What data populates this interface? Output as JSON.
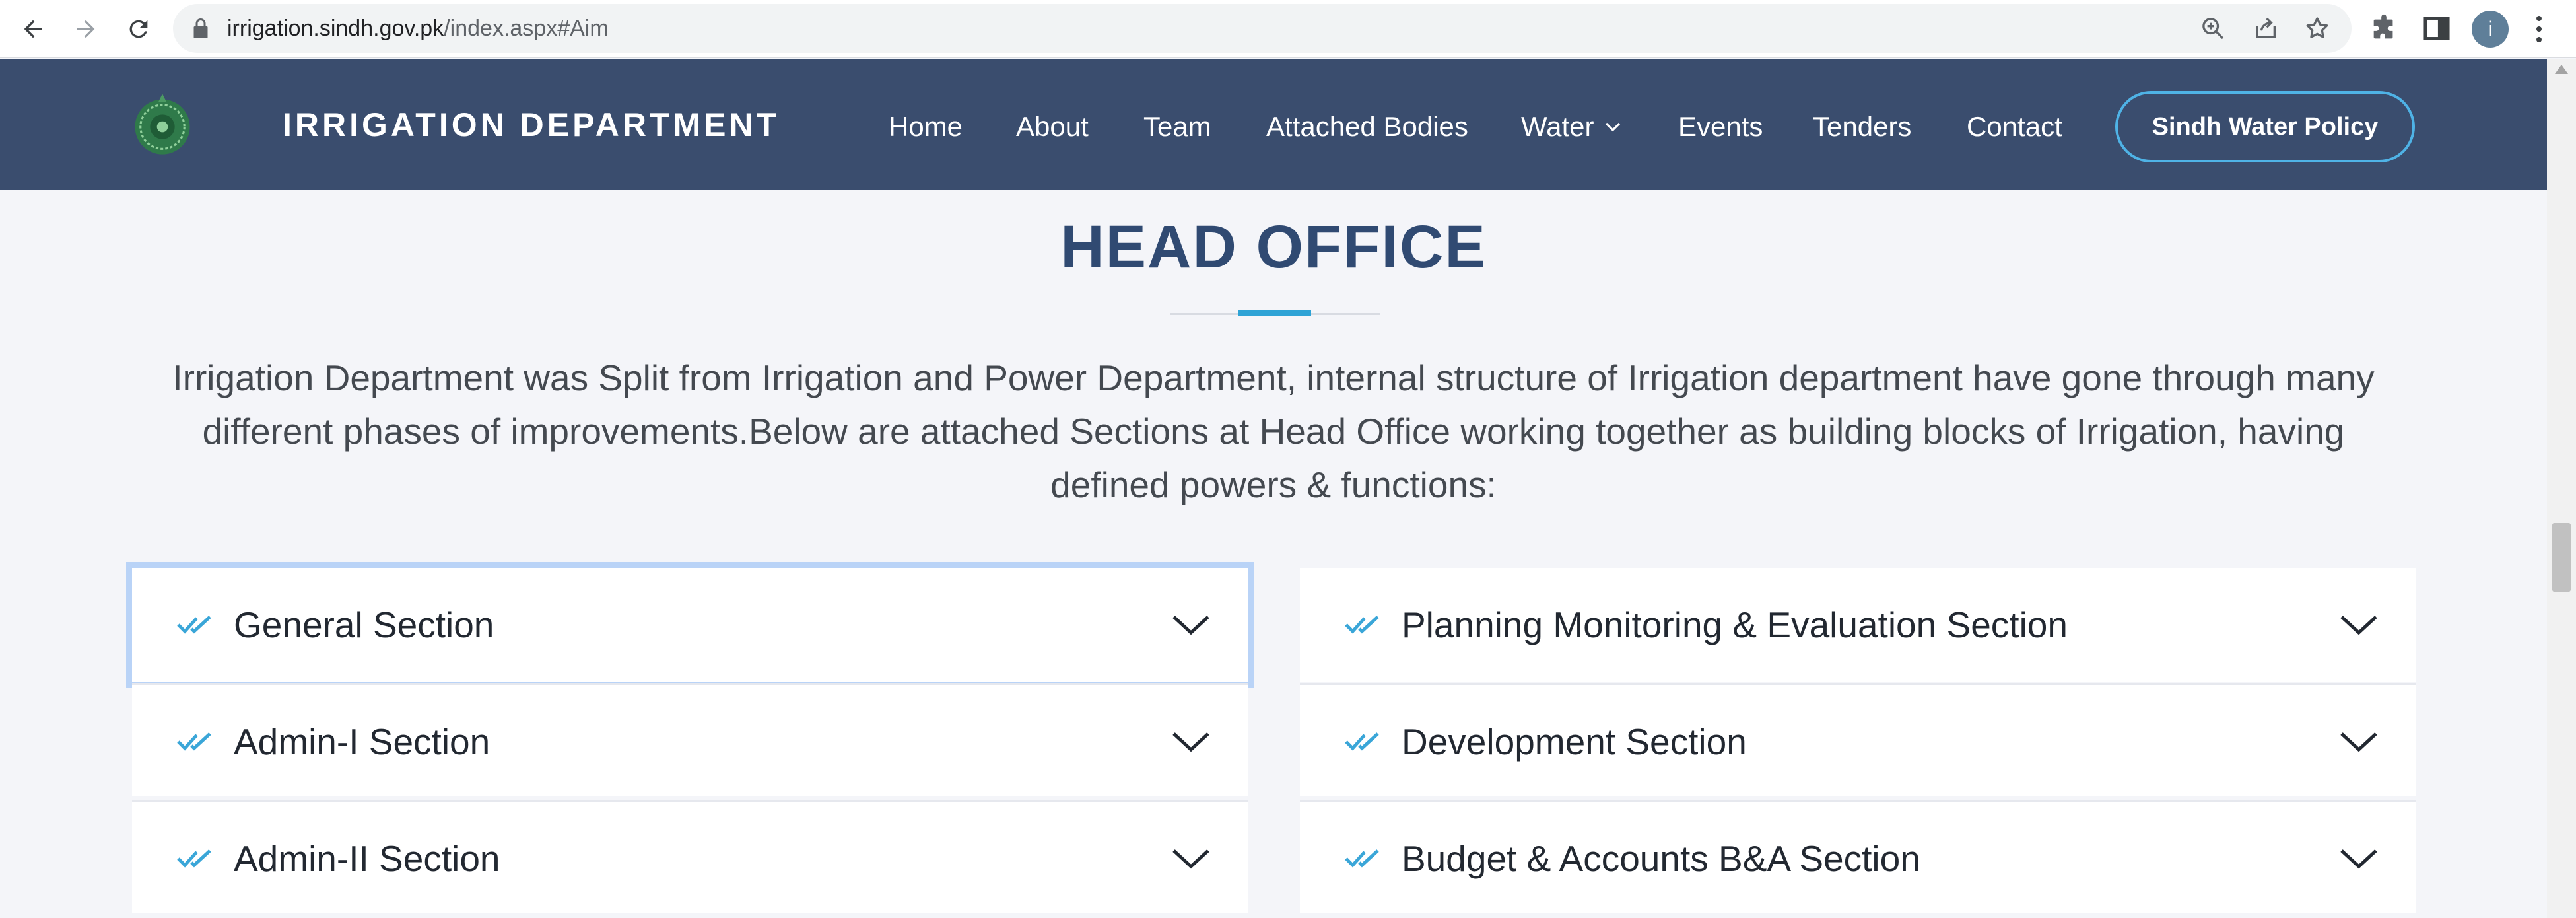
{
  "browser": {
    "url_domain": "irrigation.sindh.gov.pk",
    "url_path": "/index.aspx#Aim",
    "profile_initial": "i"
  },
  "header": {
    "site_title": "IRRIGATION DEPARTMENT",
    "menu": [
      {
        "label": "Home"
      },
      {
        "label": "About"
      },
      {
        "label": "Team"
      },
      {
        "label": "Attached Bodies"
      },
      {
        "label": "Water"
      },
      {
        "label": "Events"
      },
      {
        "label": "Tenders"
      },
      {
        "label": "Contact"
      }
    ],
    "policy_button": "Sindh Water Policy"
  },
  "main": {
    "heading": "HEAD OFFICE",
    "intro": "Irrigation Department was Split from Irrigation and Power Department, internal structure of Irrigation department have gone through many different phases of improvements.Below are attached Sections at Head Office working together as building blocks of Irrigation, having defined powers & functions:",
    "sections_left": [
      {
        "label": "General Section"
      },
      {
        "label": "Admin-I Section"
      },
      {
        "label": "Admin-II Section"
      }
    ],
    "sections_right": [
      {
        "label": "Planning Monitoring & Evaluation Section"
      },
      {
        "label": "Development Section"
      },
      {
        "label": "Budget & Accounts B&A Section"
      }
    ]
  },
  "colors": {
    "header_bg": "#3a4d6e",
    "heading": "#304a72",
    "accent": "#2ea3d6",
    "focus_ring": "#b9d3f7"
  }
}
